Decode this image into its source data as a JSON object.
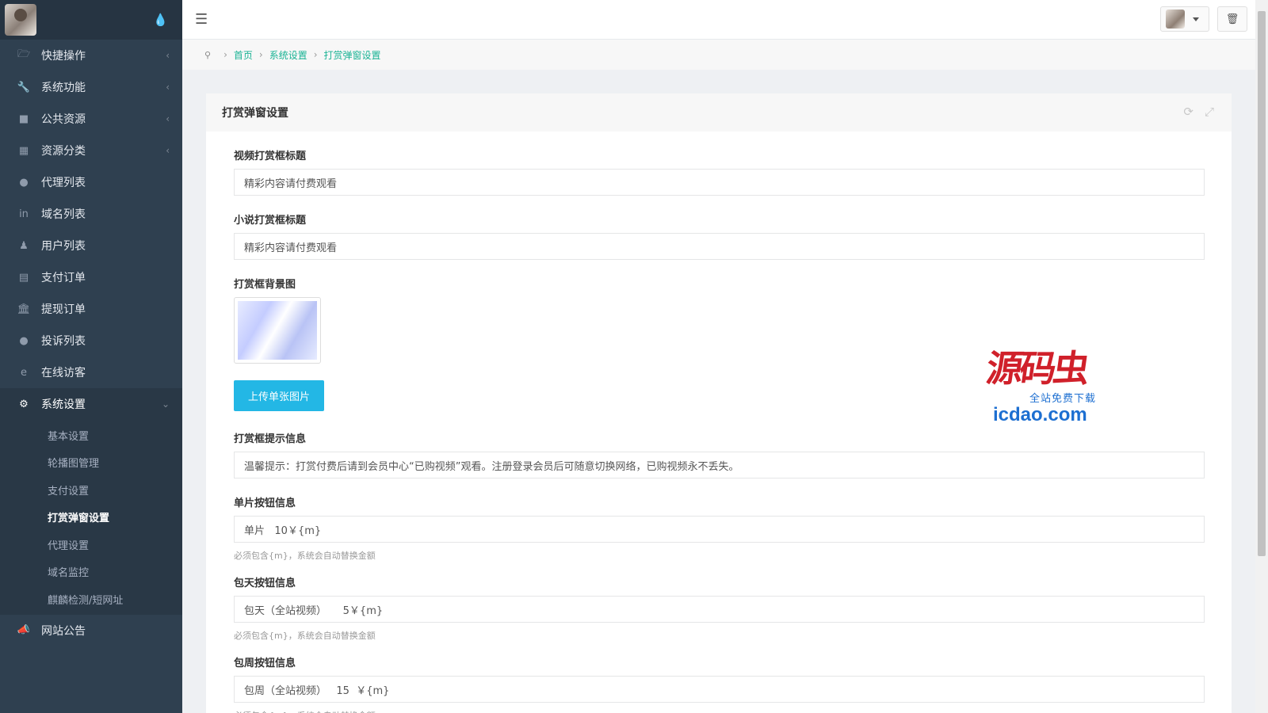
{
  "sidebar": {
    "menu": [
      {
        "label": "快捷操作",
        "icon": "folder-icon"
      },
      {
        "label": "系统功能",
        "icon": "wrench-icon"
      },
      {
        "label": "公共资源",
        "icon": "video-camera-icon"
      },
      {
        "label": "资源分类",
        "icon": "grid-icon"
      },
      {
        "label": "代理列表",
        "icon": "users-icon"
      },
      {
        "label": "域名列表",
        "icon": "linkedin-icon"
      },
      {
        "label": "用户列表",
        "icon": "user-icon"
      },
      {
        "label": "支付订单",
        "icon": "database-icon"
      },
      {
        "label": "提现订单",
        "icon": "bank-icon"
      },
      {
        "label": "投诉列表",
        "icon": "exclamation-circle-icon"
      },
      {
        "label": "在线访客",
        "icon": "ie-icon"
      },
      {
        "label": "系统设置",
        "icon": "gear-icon"
      },
      {
        "label": "网站公告",
        "icon": "bullhorn-icon"
      }
    ],
    "submenu": [
      "基本设置",
      "轮播图管理",
      "支付设置",
      "打赏弹窗设置",
      "代理设置",
      "域名监控",
      "麒麟检测/短网址"
    ]
  },
  "breadcrumb": [
    "首页",
    "系统设置",
    "打赏弹窗设置"
  ],
  "panel": {
    "title": "打赏弹窗设置",
    "fields": {
      "video_title_label": "视频打赏框标题",
      "video_title_value": "精彩内容请付费观看",
      "novel_title_label": "小说打赏框标题",
      "novel_title_value": "精彩内容请付费观看",
      "bg_label": "打赏框背景图",
      "upload_label": "上传单张图片",
      "tip_label": "打赏框提示信息",
      "tip_value": "温馨提示：打赏付费后请到会员中心“已购视频”观看。注册登录会员后可随意切换网络，已购视频永不丢失。",
      "single_label": "单片按钮信息",
      "single_value": "单片   10￥{m}",
      "day_label": "包天按钮信息",
      "day_value": "包天（全站视频）     5￥{m}",
      "week_label": "包周按钮信息",
      "week_value": "包周（全站视频）   15  ￥{m}",
      "help_text": "必须包含{m}，系统会自动替换金额"
    }
  },
  "watermark": {
    "logo": "源码虫",
    "tagline": "全站免费下载",
    "domain": "icdao.com"
  }
}
